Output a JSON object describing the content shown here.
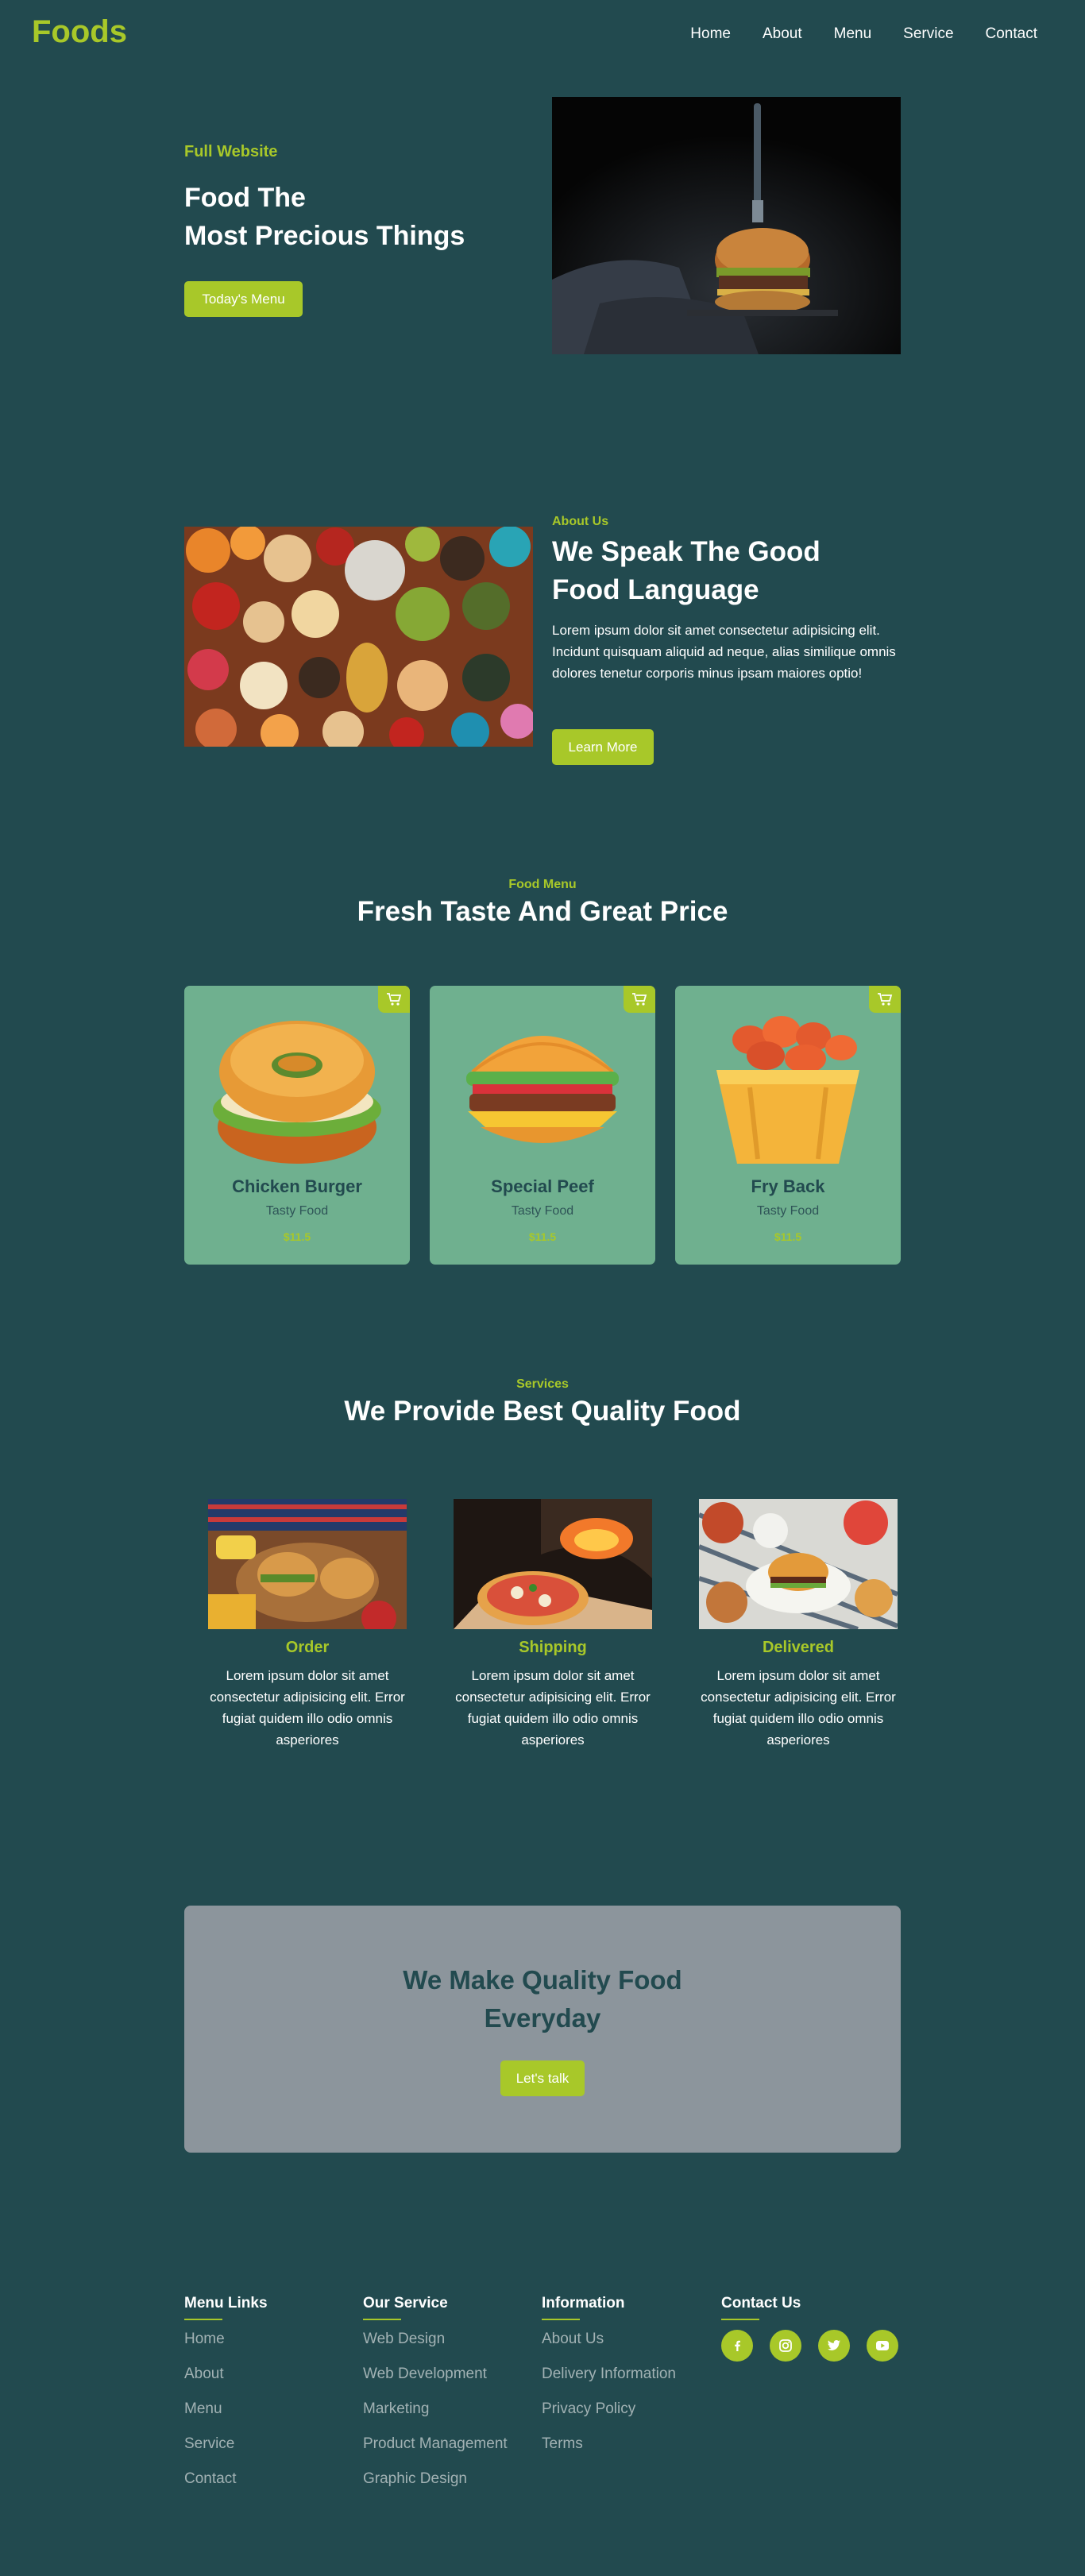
{
  "header": {
    "logo": "Foods",
    "nav": [
      "Home",
      "About",
      "Menu",
      "Service",
      "Contact"
    ]
  },
  "hero": {
    "eyebrow": "Full Website",
    "title_line1": "Food The",
    "title_line2": "Most Precious Things",
    "button": "Today's Menu"
  },
  "about": {
    "eyebrow": "About Us",
    "title_line1": "We Speak The Good",
    "title_line2": "Food Language",
    "text": "Lorem ipsum dolor sit amet consectetur adipisicing elit. Incidunt quisquam aliquid ad neque, alias similique omnis dolores tenetur corporis minus ipsam maiores optio!",
    "button": "Learn More"
  },
  "menu": {
    "eyebrow": "Food Menu",
    "title": "Fresh Taste And Great Price",
    "items": [
      {
        "name": "Chicken Burger",
        "sub": "Tasty Food",
        "price": "$11.5"
      },
      {
        "name": "Special Peef",
        "sub": "Tasty Food",
        "price": "$11.5"
      },
      {
        "name": "Fry Back",
        "sub": "Tasty Food",
        "price": "$11.5"
      }
    ]
  },
  "services": {
    "eyebrow": "Services",
    "title": "We Provide Best Quality Food",
    "items": [
      {
        "name": "Order",
        "text": "Lorem ipsum dolor sit amet consectetur adipisicing elit. Error fugiat quidem illo odio omnis asperiores"
      },
      {
        "name": "Shipping",
        "text": "Lorem ipsum dolor sit amet consectetur adipisicing elit. Error fugiat quidem illo odio omnis asperiores"
      },
      {
        "name": "Delivered",
        "text": "Lorem ipsum dolor sit amet consectetur adipisicing elit. Error fugiat quidem illo odio omnis asperiores"
      }
    ]
  },
  "cta": {
    "title_line1": "We Make Quality Food",
    "title_line2": "Everyday",
    "button": "Let's talk"
  },
  "footer": {
    "menu_links": {
      "heading": "Menu Links",
      "links": [
        "Home",
        "About",
        "Menu",
        "Service",
        "Contact"
      ]
    },
    "our_service": {
      "heading": "Our Service",
      "links": [
        "Web Design",
        "Web Development",
        "Marketing",
        "Product Management",
        "Graphic Design"
      ]
    },
    "information": {
      "heading": "Information",
      "links": [
        "About Us",
        "Delivery Information",
        "Privacy Policy",
        "Terms"
      ]
    },
    "contact": {
      "heading": "Contact Us",
      "socials": [
        "facebook-icon",
        "instagram-icon",
        "twitter-icon",
        "youtube-icon"
      ]
    }
  },
  "colors": {
    "background": "#224a4f",
    "accent": "#a8c829",
    "card": "#6fb08f",
    "cta": "#8c959c"
  }
}
